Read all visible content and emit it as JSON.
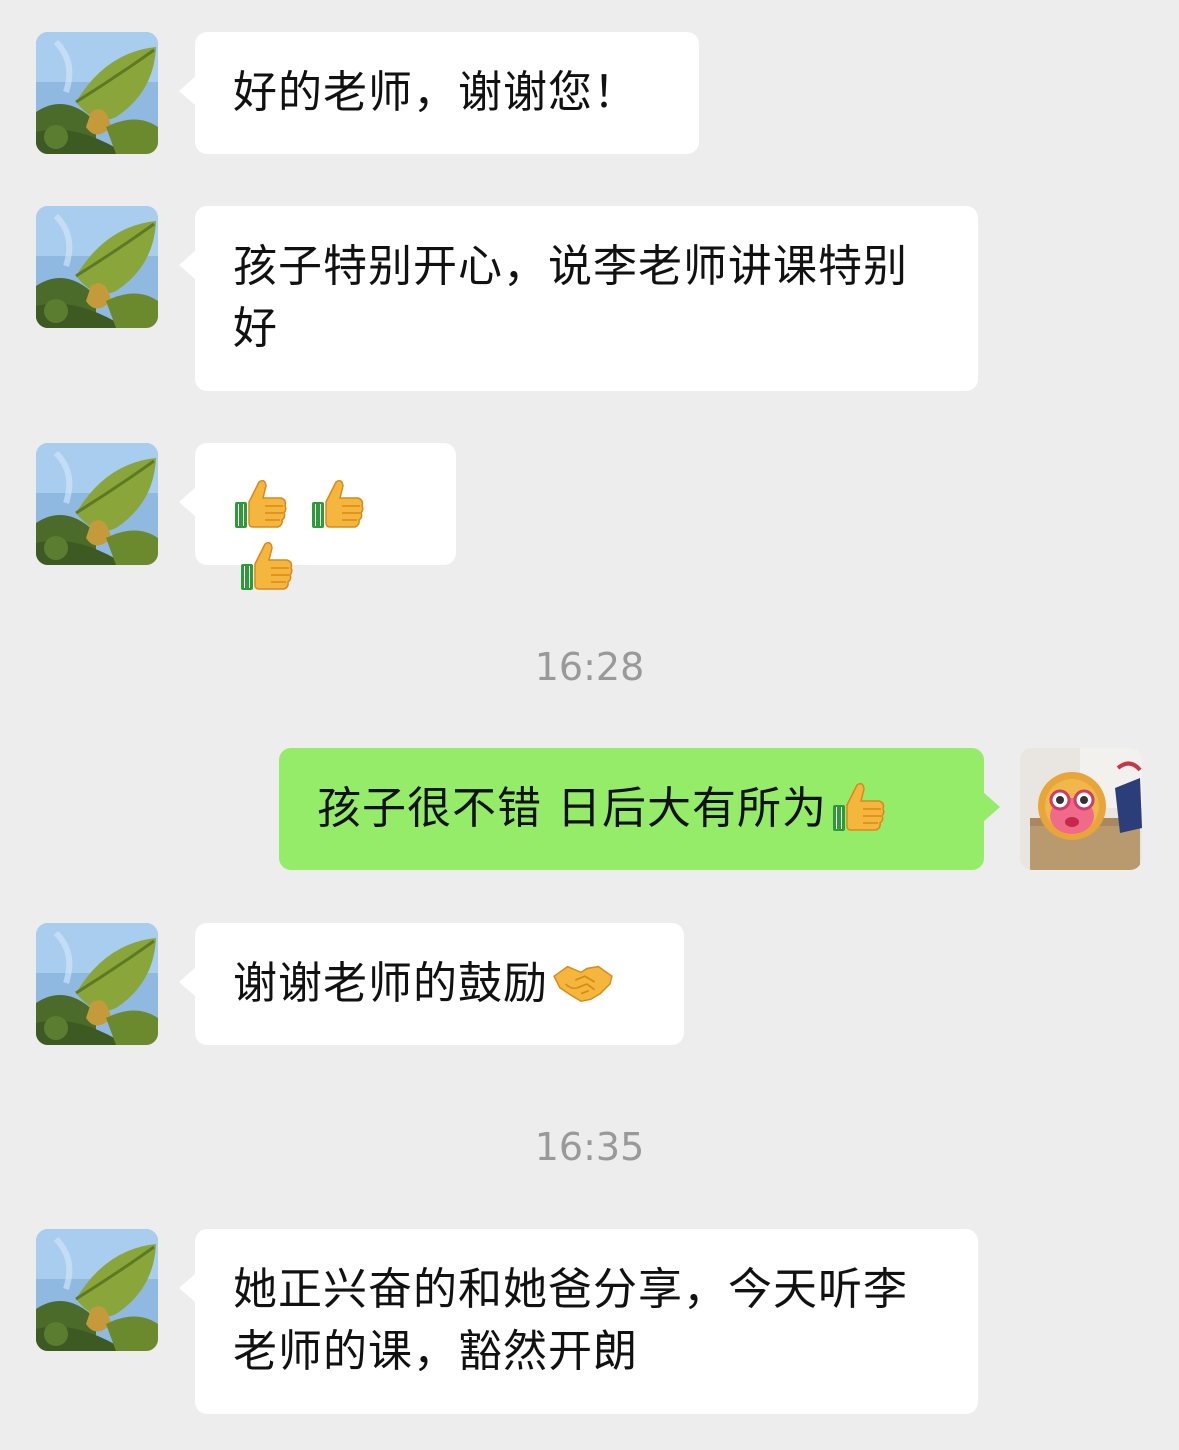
{
  "messages": [
    {
      "sender": "other",
      "text": "好的老师，谢谢您！"
    },
    {
      "sender": "other",
      "text": "孩子特别开心，说李老师讲课特别好"
    },
    {
      "sender": "other",
      "emojis": [
        "thumbs-up-icon",
        "thumbs-up-icon",
        "thumbs-up-icon"
      ]
    },
    {
      "timestamp": "16:28"
    },
    {
      "sender": "self",
      "text": "孩子很不错 日后大有所为",
      "emoji": "thumbs-up-icon"
    },
    {
      "sender": "other",
      "text": "谢谢老师的鼓励",
      "emoji": "handshake-icon"
    },
    {
      "timestamp": "16:35"
    },
    {
      "sender": "other",
      "text": "她正兴奋的和她爸分享，今天听李老师的课，豁然开朗"
    }
  ],
  "colors": {
    "background": "#ededed",
    "incoming_bubble": "#ffffff",
    "outgoing_bubble": "#95ec69",
    "timestamp_text": "#999999"
  },
  "avatars": {
    "other": "leaf-photo-avatar",
    "self": "toy-photo-avatar"
  }
}
